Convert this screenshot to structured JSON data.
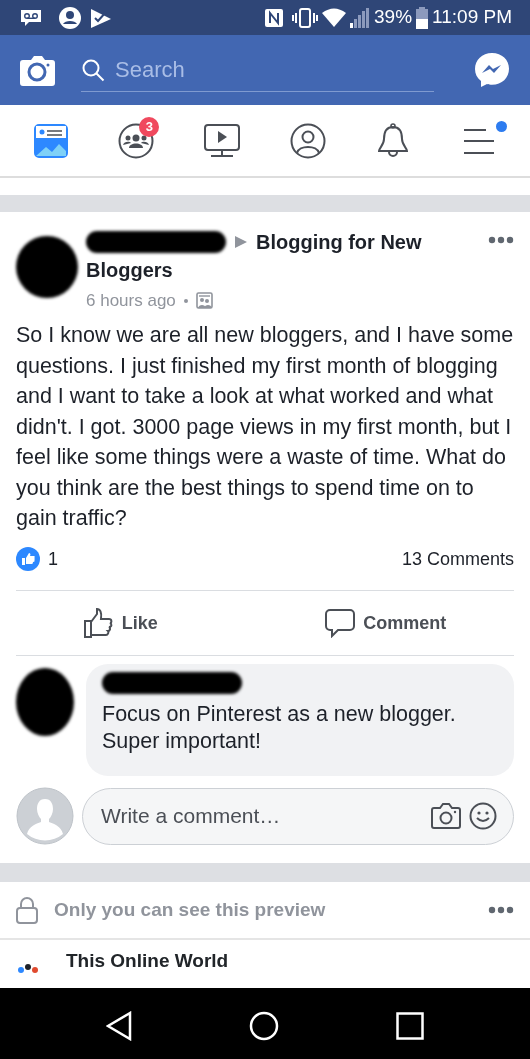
{
  "status_bar": {
    "battery": "39%",
    "time": "11:09 PM"
  },
  "header": {
    "search": {
      "placeholder": "Search"
    }
  },
  "tabs": [
    {
      "kind": "feed",
      "selected": true
    },
    {
      "kind": "groups",
      "selected": false,
      "badge": "3"
    },
    {
      "kind": "watch",
      "selected": false
    },
    {
      "kind": "profile",
      "selected": false
    },
    {
      "kind": "notifications",
      "selected": false
    },
    {
      "kind": "menu",
      "selected": false,
      "notice": true
    }
  ],
  "post": {
    "group": "Blogging for New Bloggers",
    "time": "6 hours ago",
    "body": "So I know we are all new bloggers, and I have some questions. I just finished my first month of blogging and I want to take a look at what worked and what didn't. I got. 3000 page views in my first month, but I feel like some things were a waste of time. What do you think are the best things to spend time on to gain traffic?",
    "likes": "1",
    "comments": "13 Comments",
    "actions": [
      {
        "kind": "like",
        "label": "Like"
      },
      {
        "kind": "comment",
        "label": "Comment"
      }
    ],
    "comment": {
      "text": "Focus on Pinterest as a new blogger. Super important!"
    },
    "composer": {
      "placeholder": "Write a comment…"
    }
  },
  "preview": {
    "text": "Only you can see this preview"
  },
  "next_post": {
    "name": "This Online World"
  }
}
